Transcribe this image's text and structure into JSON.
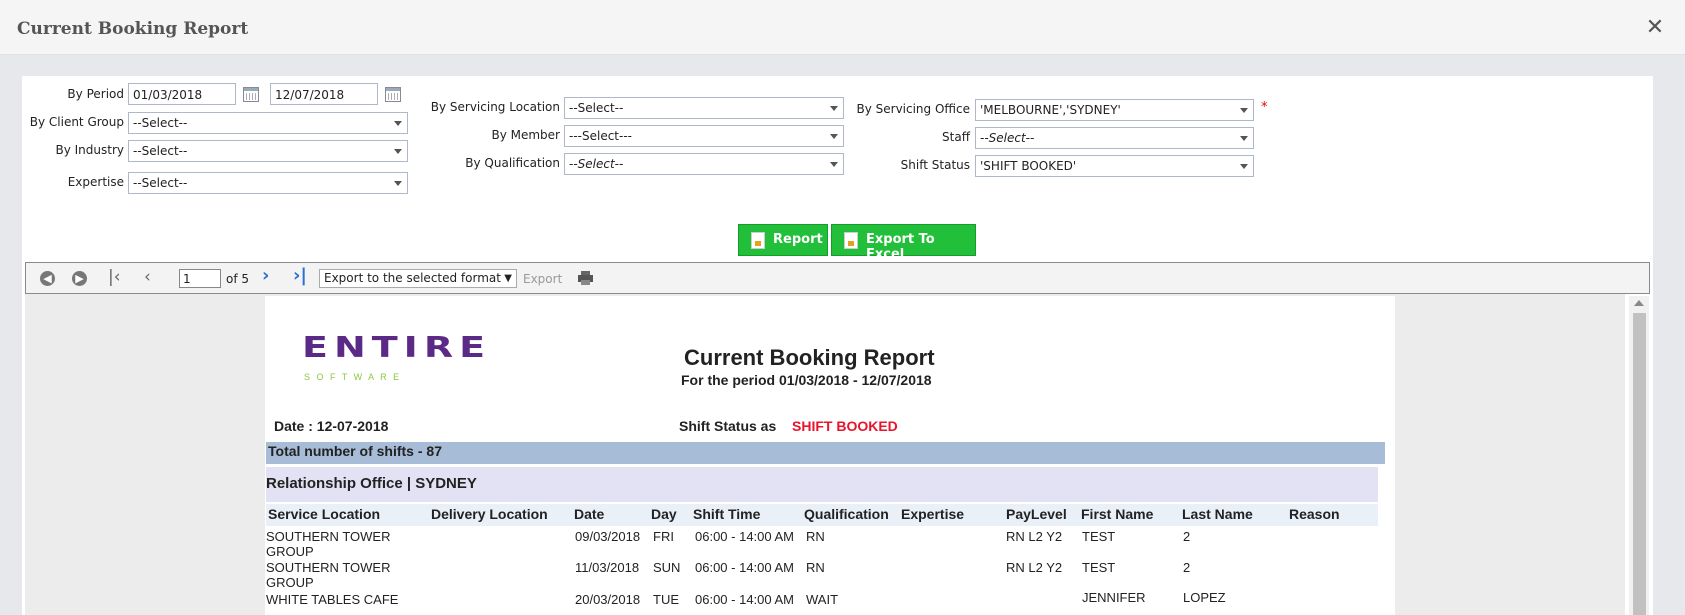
{
  "window": {
    "title": "Current Booking Report"
  },
  "filters": {
    "by_period_label": "By Period",
    "period_from": "01/03/2018",
    "period_to": "12/07/2018",
    "client_group_label": "By Client Group",
    "client_group_value": "--Select--",
    "industry_label": "By Industry",
    "industry_value": "--Select--",
    "expertise_label": "Expertise",
    "expertise_value": "--Select--",
    "servicing_location_label": "By Servicing Location",
    "servicing_location_value": "--Select--",
    "member_label": "By Member",
    "member_value": "---Select---",
    "qualification_label": "By Qualification",
    "qualification_value": "--Select--",
    "servicing_office_label": "By Servicing Office",
    "servicing_office_value": "'MELBOURNE','SYDNEY'",
    "required_mark": "*",
    "staff_label": "Staff",
    "staff_value": "--Select--",
    "shift_status_label": "Shift Status",
    "shift_status_value": "'SHIFT BOOKED'"
  },
  "actions": {
    "report_label": "Report",
    "export_excel_label": "Export To Excel"
  },
  "toolbar": {
    "page_number": "1",
    "page_of": "of 5",
    "format_select": "Export to the selected format",
    "export_label": "Export"
  },
  "report": {
    "logo_main": "ENTIRE",
    "logo_sub": "S O F T W A R E",
    "title": "Current Booking Report",
    "period_line": "For the period 01/03/2018 - 12/07/2018",
    "date_line": "Date : 12-07-2018",
    "shift_status_prefix": "Shift Status as",
    "shift_status_value": "SHIFT BOOKED",
    "total_line": "Total number of shifts - 87",
    "group_line": "Relationship Office | SYDNEY",
    "columns": [
      "Service Location",
      "Delivery Location",
      "Date",
      "Day",
      "Shift Time",
      "Qualification",
      "Expertise",
      "PayLevel",
      "First Name",
      "Last Name",
      "Reason"
    ],
    "rows": [
      {
        "service_location": "SOUTHERN TOWER",
        "service_location_2": "GROUP",
        "delivery_location": "",
        "date": "09/03/2018",
        "day": "FRI",
        "shift_time": "06:00 - 14:00 AM",
        "qualification": "RN",
        "expertise": "",
        "pay_level": "RN L2 Y2",
        "first_name": "TEST",
        "last_name": "2",
        "reason": ""
      },
      {
        "service_location": "SOUTHERN TOWER",
        "service_location_2": "GROUP",
        "delivery_location": "",
        "date": "11/03/2018",
        "day": "SUN",
        "shift_time": "06:00 - 14:00 AM",
        "qualification": "RN",
        "expertise": "",
        "pay_level": "RN L2 Y2",
        "first_name": "TEST",
        "last_name": "2",
        "reason": ""
      },
      {
        "service_location": "WHITE TABLES CAFE",
        "service_location_2": "",
        "delivery_location": "",
        "date": "20/03/2018",
        "day": "TUE",
        "shift_time": "06:00 - 14:00 AM",
        "qualification": "WAIT",
        "expertise": "",
        "pay_level": "",
        "first_name": "JENNIFER",
        "last_name": "LOPEZ",
        "reason": ""
      }
    ]
  },
  "colors": {
    "button_green": "#22c03a",
    "status_red": "#e8142a",
    "logo_purple": "#5b2a86",
    "logo_green": "#8dc63f",
    "total_band": "#a7bcd6",
    "group_band": "#e2e2f4"
  },
  "icons": [
    "close-icon",
    "calendar-icon",
    "back-icon",
    "forward-icon",
    "first-page-icon",
    "prev-page-icon",
    "next-page-icon",
    "last-page-icon",
    "print-icon",
    "report-doc-icon",
    "excel-doc-icon"
  ]
}
